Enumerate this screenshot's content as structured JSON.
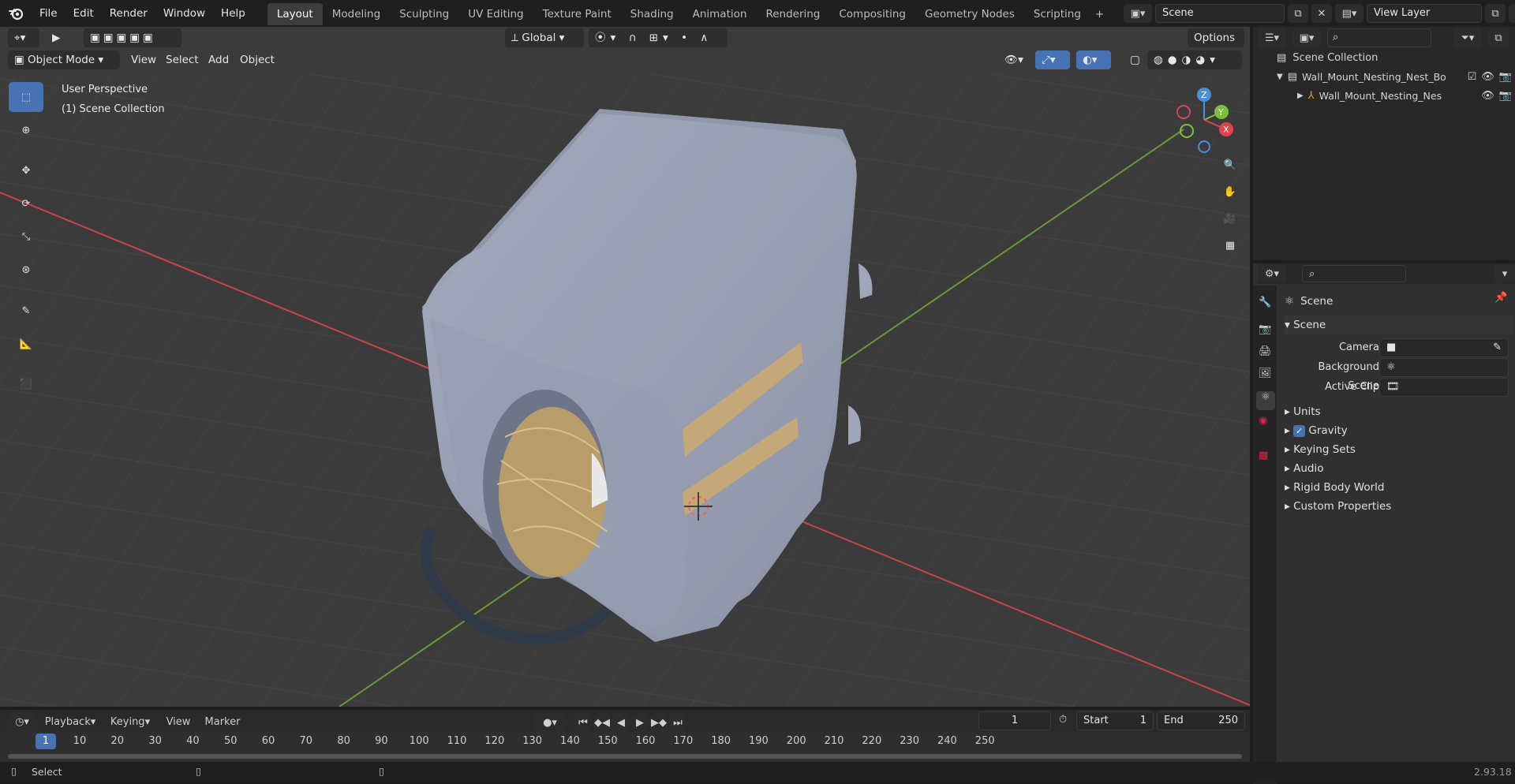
{
  "topbar": {
    "menus": [
      "File",
      "Edit",
      "Render",
      "Window",
      "Help"
    ],
    "workspaces": [
      "Layout",
      "Modeling",
      "Sculpting",
      "UV Editing",
      "Texture Paint",
      "Shading",
      "Animation",
      "Rendering",
      "Compositing",
      "Geometry Nodes",
      "Scripting"
    ],
    "active_workspace": "Layout",
    "add_workspace": "+",
    "scene_name": "Scene",
    "view_layer": "View Layer"
  },
  "viewport": {
    "mode": "Object Mode",
    "menus": [
      "View",
      "Select",
      "Add",
      "Object"
    ],
    "transform_orientation": "Global",
    "options_label": "Options",
    "overlay_line1": "User Perspective",
    "overlay_line2": "(1) Scene Collection",
    "gizmo": {
      "z": "Z",
      "y": "Y",
      "x": "X"
    }
  },
  "outliner": {
    "root": "Scene Collection",
    "items": [
      {
        "label": "Wall_Mount_Nesting_Nest_Bo"
      },
      {
        "label": "Wall_Mount_Nesting_Nes"
      }
    ]
  },
  "properties": {
    "context_title": "Scene",
    "panel_title": "Scene",
    "camera_label": "Camera",
    "background_scene_label": "Background Scene",
    "active_clip_label": "Active Clip",
    "sections": [
      "Units",
      "Gravity",
      "Keying Sets",
      "Audio",
      "Rigid Body World",
      "Custom Properties"
    ],
    "gravity_checked": true
  },
  "timeline": {
    "menus": [
      "Playback",
      "Keying",
      "View",
      "Marker"
    ],
    "current_frame": "1",
    "start_label": "Start",
    "start_value": "1",
    "end_label": "End",
    "end_value": "250",
    "ruler": [
      "1",
      "10",
      "20",
      "30",
      "40",
      "50",
      "60",
      "70",
      "80",
      "90",
      "100",
      "110",
      "120",
      "130",
      "140",
      "150",
      "160",
      "170",
      "180",
      "190",
      "200",
      "210",
      "220",
      "230",
      "240",
      "250"
    ]
  },
  "status": {
    "left": "Select",
    "version": "2.93.18"
  },
  "colors": {
    "accent": "#4772b3",
    "x_axis": "#c8454b",
    "y_axis": "#6a9a35",
    "object": "#9ea5b8"
  }
}
